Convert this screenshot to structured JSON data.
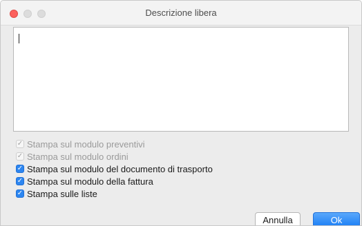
{
  "window": {
    "title": "Descrizione libera"
  },
  "textarea": {
    "value": ""
  },
  "checkboxes": [
    {
      "label": "Stampa sul modulo preventivi",
      "checked": true,
      "enabled": false
    },
    {
      "label": "Stampa sul modulo ordini",
      "checked": true,
      "enabled": false
    },
    {
      "label": "Stampa sul modulo del documento di trasporto",
      "checked": true,
      "enabled": true
    },
    {
      "label": "Stampa sul modulo della fattura",
      "checked": true,
      "enabled": true
    },
    {
      "label": "Stampa sulle liste",
      "checked": true,
      "enabled": true
    }
  ],
  "buttons": {
    "cancel_label": "Annulla",
    "ok_label": "Ok"
  },
  "colors": {
    "accent": "#2d86f0",
    "close": "#fc605c"
  }
}
